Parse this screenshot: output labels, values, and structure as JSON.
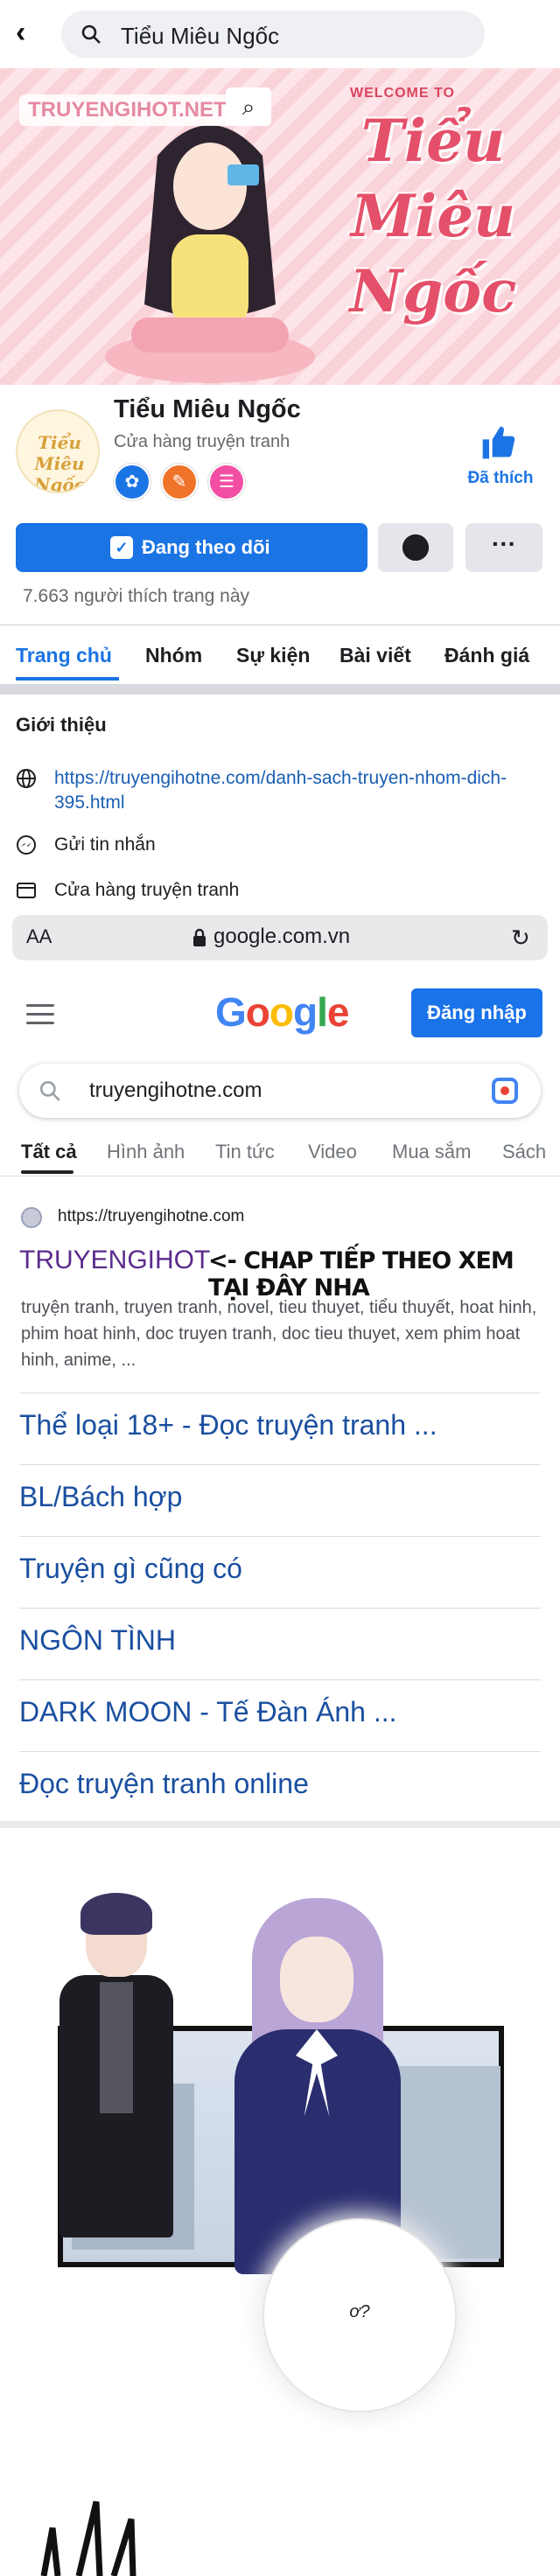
{
  "top_search": {
    "query": "Tiểu Miêu Ngốc"
  },
  "cover": {
    "watermark": "TRUYENGIHOT.NET",
    "welcome": "WELCOME TO",
    "title_art": "Tiểu Miêu Ngốc"
  },
  "page": {
    "avatar_text": "Tiểu Miêu Ngốc",
    "name": "Tiểu Miêu Ngốc",
    "category": "Cửa hàng truyện tranh",
    "like_label": "Đã thích",
    "follow_label": "Đang theo dõi",
    "more_label": "···",
    "likes_count": "7.663 người thích trang này"
  },
  "tabs": [
    {
      "label": "Trang chủ"
    },
    {
      "label": "Nhóm"
    },
    {
      "label": "Sự kiện"
    },
    {
      "label": "Bài viết"
    },
    {
      "label": "Đánh giá"
    }
  ],
  "intro": {
    "heading": "Giới thiệu",
    "link": "https://truyengihotne.com/danh-sach-truyen-nhom-dich-395.html",
    "message": "Gửi tin nhắn",
    "shop": "Cửa hàng truyện tranh"
  },
  "browser": {
    "text_size": "AA",
    "url": "google.com.vn",
    "reload_glyph": "↻"
  },
  "google": {
    "logo": {
      "letters": [
        "G",
        "o",
        "o",
        "g",
        "l",
        "e"
      ],
      "colors": [
        "#4285f4",
        "#ea4335",
        "#fbbc05",
        "#4285f4",
        "#34a853",
        "#ea4335"
      ]
    },
    "signin": "Đăng nhập",
    "query": "truyengihotne.com",
    "tabs": [
      {
        "label": "Tất cả"
      },
      {
        "label": "Hình ảnh"
      },
      {
        "label": "Tin tức"
      },
      {
        "label": "Video"
      },
      {
        "label": "Mua sắm"
      },
      {
        "label": "Sách"
      }
    ],
    "result": {
      "url": "https://truyengihotne.com",
      "title": "TRUYENGIHOT",
      "banner": "<- CHAP TIẾP THEO XEM TẠI ĐÂY NHA",
      "snippet": "truyện tranh, truyen tranh, novel, tieu thuyet, tiểu thuyết, hoat hinh, phim hoat hinh, doc truyen tranh, doc tieu thuyet, xem phim hoat hinh, anime, ..."
    },
    "sitelinks": [
      {
        "label": "Thể loại 18+ - Đọc truyện tranh ..."
      },
      {
        "label": "BL/Bách hợp"
      },
      {
        "label": "Truyện gì cũng có"
      },
      {
        "label": "NGÔN TÌNH"
      },
      {
        "label": "DARK MOON - Tế Đàn Ánh ..."
      },
      {
        "label": "Đọc truyện tranh online"
      }
    ]
  },
  "comic": {
    "bubble_text": "ơ?"
  },
  "colors": {
    "facebook_blue": "#1b74e4",
    "google_blue": "#1a73e8",
    "visited_title": "#5b2b8c"
  }
}
